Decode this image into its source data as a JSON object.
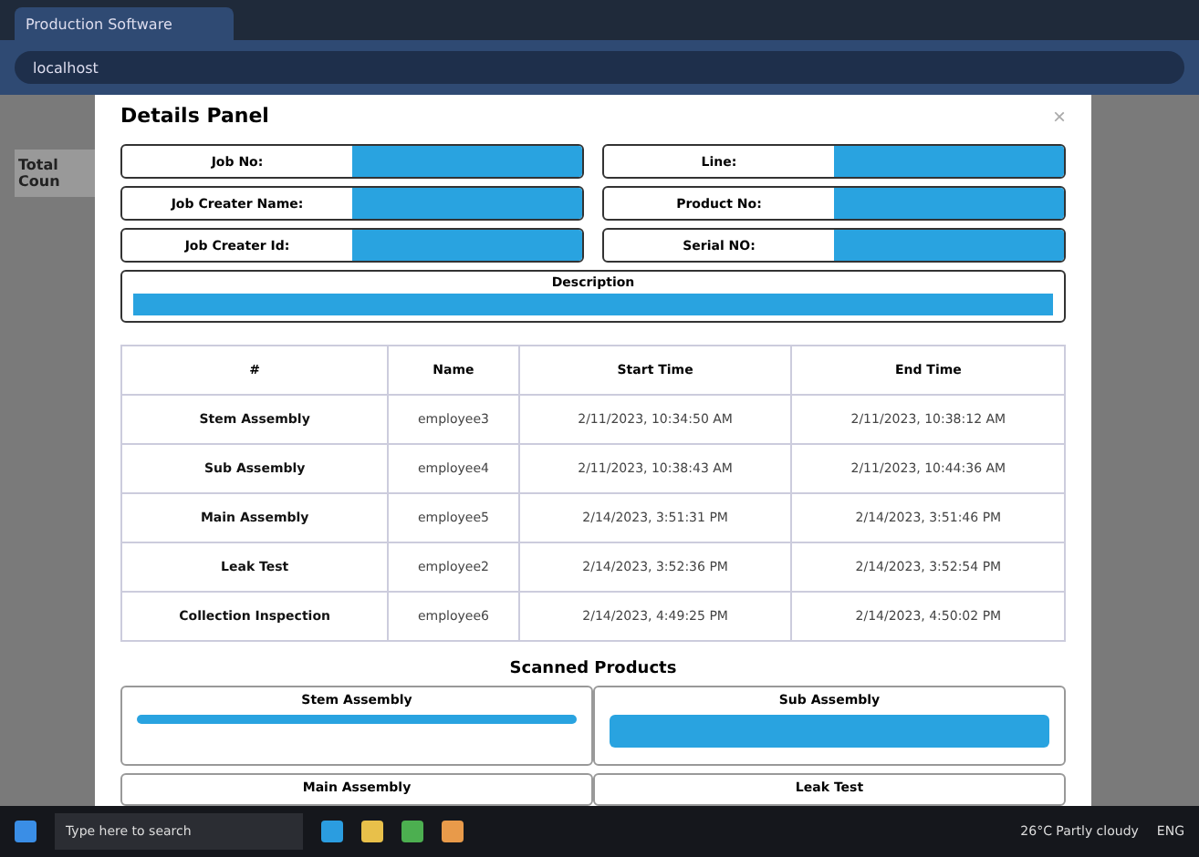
{
  "browser": {
    "tab_title": "Production Software",
    "address": "localhost"
  },
  "background": {
    "label": "Total Coun"
  },
  "modal": {
    "title": "Details Panel",
    "close": "×",
    "fields": [
      {
        "label": "Job No:"
      },
      {
        "label": "Line:"
      },
      {
        "label": "Job Creater Name:"
      },
      {
        "label": "Product No:"
      },
      {
        "label": "Job Creater Id:"
      },
      {
        "label": "Serial NO:"
      }
    ],
    "description": {
      "label": "Description"
    },
    "table": {
      "columns": [
        "#",
        "Name",
        "Start Time",
        "End Time"
      ],
      "rows": [
        [
          "Stem Assembly",
          "employee3",
          "2/11/2023, 10:34:50 AM",
          "2/11/2023, 10:38:12 AM"
        ],
        [
          "Sub Assembly",
          "employee4",
          "2/11/2023, 10:38:43 AM",
          "2/11/2023, 10:44:36 AM"
        ],
        [
          "Main Assembly",
          "employee5",
          "2/14/2023, 3:51:31 PM",
          "2/14/2023, 3:51:46 PM"
        ],
        [
          "Leak Test",
          "employee2",
          "2/14/2023, 3:52:36 PM",
          "2/14/2023, 3:52:54 PM"
        ],
        [
          "Collection Inspection",
          "employee6",
          "2/14/2023, 4:49:25 PM",
          "2/14/2023, 4:50:02 PM"
        ]
      ]
    },
    "scanned": {
      "title": "Scanned Products",
      "cards": [
        {
          "label": "Stem Assembly",
          "kind": "thin"
        },
        {
          "label": "Sub Assembly",
          "kind": "full"
        },
        {
          "label": "Main Assembly",
          "kind": "none"
        },
        {
          "label": "Leak Test",
          "kind": "none"
        }
      ]
    }
  },
  "taskbar": {
    "search": "Type here to search",
    "weather": "26°C Partly cloudy",
    "language": "ENG"
  }
}
